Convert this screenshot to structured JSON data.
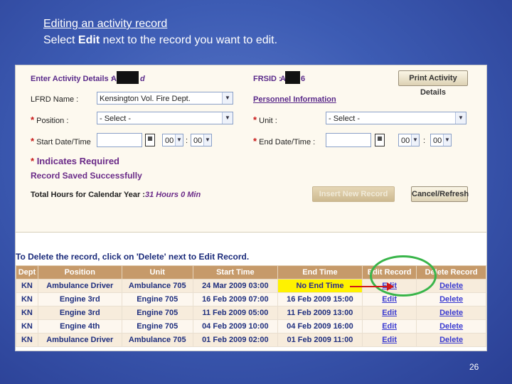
{
  "slide": {
    "title": "Editing an activity record",
    "subtitle_prefix": "Select ",
    "subtitle_bold": "Edit",
    "subtitle_suffix": " next to the record you want to edit.",
    "page_number": "26"
  },
  "form": {
    "activity_label": "Enter Activity Details :",
    "activity_visible_start": "A",
    "activity_visible_end": "d",
    "frsid_label": "FRSID :",
    "frsid_visible_start": "A",
    "frsid_visible_end": "6",
    "print_button": "Print Activity Details",
    "lfrd_label": "LFRD Name :",
    "lfrd_value": "Kensington Vol. Fire Dept.",
    "personnel_link": "Personnel Information",
    "position_label": "Position :",
    "position_value": "- Select -",
    "unit_label": "Unit :",
    "unit_value": "- Select -",
    "start_label": "Start Date/Time",
    "start_hour": "00",
    "start_min": "00",
    "end_label": "End Date/Time :",
    "end_hour": "00",
    "end_min": "00",
    "time_sep": ":",
    "required_star": "*",
    "required_note": "Indicates Required",
    "saved_msg": "Record Saved Successfully",
    "hours_label": "Total Hours for Calendar Year :",
    "hours_value": "31 Hours 0 Min",
    "insert_button": "Insert New Record",
    "cancel_button": "Cancel/Refresh"
  },
  "table": {
    "note": "To Delete the record, click on 'Delete' next to Edit Record.",
    "headers": [
      "Dept",
      "Position",
      "Unit",
      "Start Time",
      "End Time",
      "Edit Record",
      "Delete Record"
    ],
    "rows": [
      [
        "KN",
        "Ambulance Driver",
        "Ambulance 705",
        "24 Mar 2009 03:00",
        "No End Time",
        "Edit",
        "Delete"
      ],
      [
        "KN",
        "Engine 3rd",
        "Engine 705",
        "16 Feb 2009 07:00",
        "16 Feb 2009 15:00",
        "Edit",
        "Delete"
      ],
      [
        "KN",
        "Engine 3rd",
        "Engine 705",
        "11 Feb 2009 05:00",
        "11 Feb 2009 13:00",
        "Edit",
        "Delete"
      ],
      [
        "KN",
        "Engine 4th",
        "Engine 705",
        "04 Feb 2009 10:00",
        "04 Feb 2009 16:00",
        "Edit",
        "Delete"
      ],
      [
        "KN",
        "Ambulance Driver",
        "Ambulance 705",
        "01 Feb 2009 02:00",
        "01 Feb 2009 11:00",
        "Edit",
        "Delete"
      ]
    ]
  },
  "icons": {
    "dropdown": "chevron-down-icon",
    "calendar": "calendar-icon",
    "arrow": "arrow-right-icon"
  },
  "colors": {
    "highlight": "#fff200",
    "annotation_circle": "#39b54a",
    "annotation_arrow": "#d01818",
    "table_header": "#c69a6a"
  }
}
